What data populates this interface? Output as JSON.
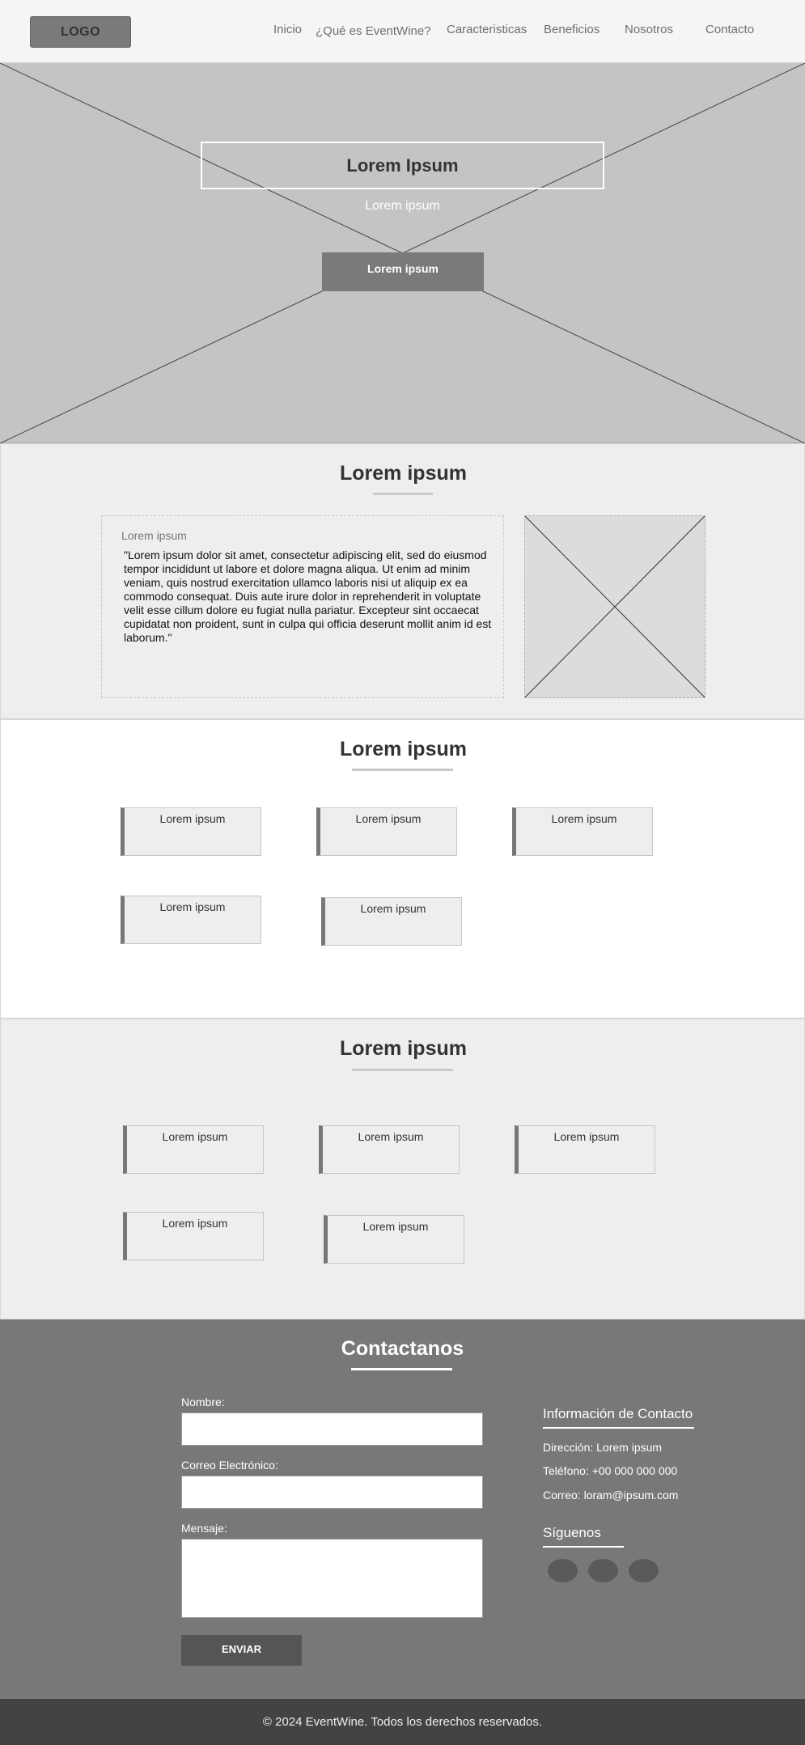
{
  "header": {
    "logo": "LOGO",
    "nav": [
      "Inicio",
      "¿Qué es EventWine?",
      "Caracteristicas",
      "Beneficios",
      "Nosotros",
      "Contacto"
    ]
  },
  "hero": {
    "title": "Lorem Ipsum",
    "subtitle": "Lorem ipsum",
    "button": "Lorem ipsum"
  },
  "about": {
    "title": "Lorem ipsum",
    "label": "Lorem ipsum",
    "text": "\"Lorem ipsum dolor sit amet, consectetur adipiscing elit, sed do eiusmod tempor incididunt ut labore et dolore magna aliqua. Ut enim ad minim veniam, quis nostrud exercitation ullamco laboris nisi ut aliquip ex ea commodo consequat. Duis aute irure dolor in reprehenderit in voluptate velit esse cillum dolore eu fugiat nulla pariatur. Excepteur sint occaecat cupidatat non proident, sunt in culpa qui officia deserunt mollit anim id est laborum.\""
  },
  "features": {
    "title": "Lorem ipsum",
    "cards": [
      "Lorem ipsum",
      "Lorem ipsum",
      "Lorem ipsum",
      "Lorem ipsum",
      "Lorem ipsum"
    ]
  },
  "benefits": {
    "title": "Lorem ipsum",
    "cards": [
      "Lorem ipsum",
      "Lorem ipsum",
      "Lorem ipsum",
      "Lorem ipsum",
      "Lorem ipsum"
    ]
  },
  "contact": {
    "title": "Contactanos",
    "form": {
      "name_label": "Nombre:",
      "email_label": "Correo Electrónico:",
      "message_label": "Mensaje:",
      "send": "ENVIAR"
    },
    "info": {
      "title": "Información de Contacto",
      "address": "Dirección: Lorem ipsum",
      "phone": "Teléfono: +00 000 000 000",
      "email": "Correo: loram@ipsum.com"
    },
    "follow": {
      "title": "Síguenos",
      "icons": [
        "social-icon",
        "social-icon",
        "social-icon"
      ]
    }
  },
  "footer": {
    "text": "© 2024 EventWine. Todos los derechos reservados."
  },
  "colors": {
    "header_bg": "#f5f5f5",
    "hero_bg": "#c4c4c4",
    "dark_gray": "#7a7a7a",
    "contact_bg": "#787878",
    "footer_bg": "#434343"
  }
}
